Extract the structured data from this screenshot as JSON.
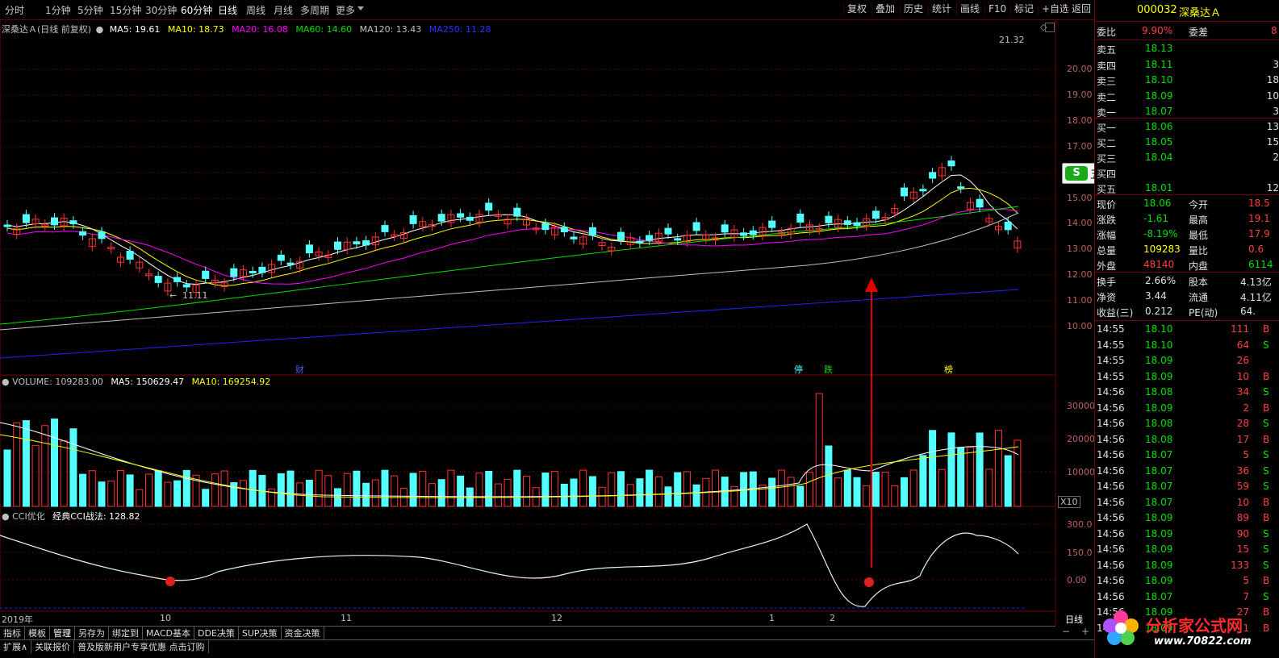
{
  "toolbar": {
    "tabs": [
      "分时",
      "1分钟",
      "5分钟",
      "15分钟",
      "30分钟",
      "60分钟",
      "日线",
      "周线",
      "月线",
      "多周期",
      "更多"
    ],
    "right_buttons": [
      "复权",
      "叠加",
      "历史",
      "统计",
      "画线",
      "F10",
      "标记",
      "+自选",
      "返回"
    ]
  },
  "legend_price": {
    "name": "深桑达Ａ(日线 前复权)",
    "ma5": "MA5: 19.61",
    "ma10": "MA10: 18.73",
    "ma20": "MA20: 16.08",
    "ma60": "MA60: 14.60",
    "ma120": "MA120: 13.43",
    "ma250": "MA250: 11.28"
  },
  "price_axis": [
    "20.00",
    "19.00",
    "18.00",
    "17.00",
    "16.00",
    "15.00",
    "14.00",
    "13.00",
    "12.00",
    "11.00",
    "10.00"
  ],
  "price_marks": {
    "high": "21.32",
    "low": "11.11"
  },
  "event_labels": {
    "cai": "财",
    "ting": "停",
    "die": "跌",
    "bang": "榜"
  },
  "legend_volume": {
    "volume": "VOLUME: 109283.00",
    "ma5": "MA5: 150629.47",
    "ma10": "MA10: 169254.92"
  },
  "volume_axis": [
    "30000",
    "20000",
    "10000"
  ],
  "volume_unit": "X10",
  "legend_cci": {
    "name": "CCI优化",
    "formula": "经典CCI战法: 128.82"
  },
  "cci_axis": [
    "300.0",
    "150.0",
    "0.00"
  ],
  "x_labels": [
    "2019年",
    "10",
    "11",
    "12",
    "1",
    "2"
  ],
  "period_label": "日线",
  "bottom_tabs": [
    "指标",
    "模板",
    "管理",
    "另存为",
    "绑定到",
    "MACD基本",
    "DDE决策",
    "SUP决策",
    "资金决策"
  ],
  "bottom_row2": [
    "扩展∧",
    "关联报价",
    "普及版新用户专享优惠 点击订购"
  ],
  "ime_toolbar": {
    "label": "五"
  },
  "stock": {
    "code": "000032",
    "name": "深桑达Ａ"
  },
  "weibi": {
    "label1": "委比",
    "value1": "9.90%",
    "label2": "委差",
    "value2": "8"
  },
  "asks": [
    {
      "label": "卖五",
      "price": "18.13",
      "vol": ""
    },
    {
      "label": "卖四",
      "price": "18.11",
      "vol": "3"
    },
    {
      "label": "卖三",
      "price": "18.10",
      "vol": "18"
    },
    {
      "label": "卖二",
      "price": "18.09",
      "vol": "10"
    },
    {
      "label": "卖一",
      "price": "18.07",
      "vol": "3"
    }
  ],
  "bids": [
    {
      "label": "买一",
      "price": "18.06",
      "vol": "13"
    },
    {
      "label": "买二",
      "price": "18.05",
      "vol": "15"
    },
    {
      "label": "买三",
      "price": "18.04",
      "vol": "2"
    },
    {
      "label": "买四",
      "price": "",
      "vol": ""
    },
    {
      "label": "买五",
      "price": "18.01",
      "vol": "12"
    }
  ],
  "quote": [
    {
      "l1": "现价",
      "v1": "18.06",
      "l2": "今开",
      "v2": "18.5"
    },
    {
      "l1": "涨跌",
      "v1": "-1.61",
      "l2": "最高",
      "v2": "19.1"
    },
    {
      "l1": "涨幅",
      "v1": "-8.19%",
      "l2": "最低",
      "v2": "17.9"
    },
    {
      "l1": "总量",
      "v1": "109283",
      "l2": "量比",
      "v2": "0.6"
    },
    {
      "l1": "外盘",
      "v1": "48140",
      "l2": "内盘",
      "v2": "6114"
    }
  ],
  "info": [
    {
      "l1": "换手",
      "v1": "2.66%",
      "l2": "股本",
      "v2": "4.13亿"
    },
    {
      "l1": "净资",
      "v1": "3.44",
      "l2": "流通",
      "v2": "4.11亿"
    },
    {
      "l1": "收益(三)",
      "v1": "0.212",
      "l2": "PE(动)",
      "v2": "64."
    }
  ],
  "ticks": [
    {
      "t": "14:55",
      "p": "18.10",
      "v": "111",
      "s": "B"
    },
    {
      "t": "14:55",
      "p": "18.10",
      "v": "64",
      "s": "S"
    },
    {
      "t": "14:55",
      "p": "18.09",
      "v": "26",
      "s": ""
    },
    {
      "t": "14:55",
      "p": "18.09",
      "v": "10",
      "s": "B"
    },
    {
      "t": "14:56",
      "p": "18.08",
      "v": "34",
      "s": "S"
    },
    {
      "t": "14:56",
      "p": "18.09",
      "v": "2",
      "s": "B"
    },
    {
      "t": "14:56",
      "p": "18.08",
      "v": "28",
      "s": "S"
    },
    {
      "t": "14:56",
      "p": "18.08",
      "v": "17",
      "s": "B"
    },
    {
      "t": "14:56",
      "p": "18.07",
      "v": "5",
      "s": "S"
    },
    {
      "t": "14:56",
      "p": "18.07",
      "v": "36",
      "s": "S"
    },
    {
      "t": "14:56",
      "p": "18.07",
      "v": "59",
      "s": "S"
    },
    {
      "t": "14:56",
      "p": "18.07",
      "v": "10",
      "s": "B"
    },
    {
      "t": "14:56",
      "p": "18.09",
      "v": "89",
      "s": "B"
    },
    {
      "t": "14:56",
      "p": "18.09",
      "v": "90",
      "s": "S"
    },
    {
      "t": "14:56",
      "p": "18.09",
      "v": "15",
      "s": "S"
    },
    {
      "t": "14:56",
      "p": "18.09",
      "v": "133",
      "s": "S"
    },
    {
      "t": "14:56",
      "p": "18.09",
      "v": "5",
      "s": "B"
    },
    {
      "t": "14:56",
      "p": "18.07",
      "v": "7",
      "s": "S"
    },
    {
      "t": "14:56",
      "p": "18.09",
      "v": "27",
      "s": "B"
    },
    {
      "t": "14:56",
      "p": "18.09",
      "v": "1",
      "s": "B"
    }
  ],
  "watermark": {
    "brand": "分析家公式网",
    "url": "www.70822.com"
  },
  "colors": {
    "up": "#ff3232",
    "down": "#54ffff",
    "ma5": "#ffffff",
    "ma10": "#ffff00",
    "ma20": "#ff00ff",
    "ma60": "#00e000",
    "ma120": "#c0c0c0",
    "ma250": "#2020ff",
    "arrow": "#e00000"
  }
}
